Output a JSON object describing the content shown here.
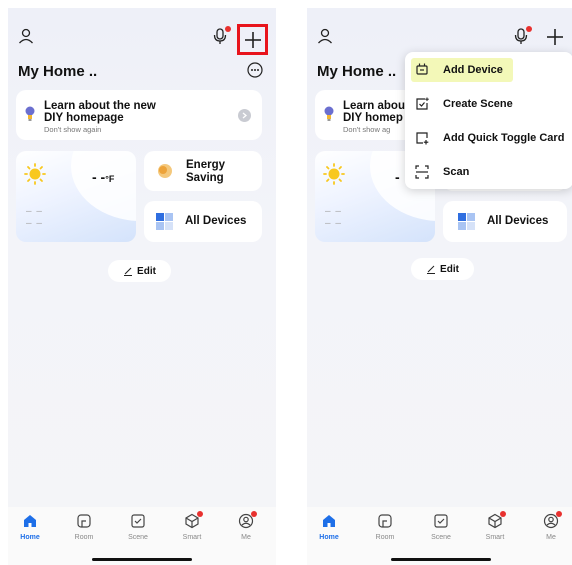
{
  "left": {
    "header": {
      "title": "My Home .."
    },
    "banner": {
      "title_line1": "Learn about the new",
      "title_line2": "DIY homepage",
      "subtitle": "Don't show again"
    },
    "weather": {
      "temperature": "- -",
      "unit": "°F",
      "placeholder_line1": "– –",
      "placeholder_line2": "– –"
    },
    "energy": {
      "line1": "Energy",
      "line2": "Saving"
    },
    "all_devices": {
      "label": "All Devices"
    },
    "edit": {
      "label": "Edit"
    },
    "tabs": [
      {
        "label": "Home",
        "icon": "home-icon"
      },
      {
        "label": "Room",
        "icon": "room-icon"
      },
      {
        "label": "Scene",
        "icon": "scene-icon"
      },
      {
        "label": "Smart",
        "icon": "smart-icon"
      },
      {
        "label": "Me",
        "icon": "me-icon"
      }
    ]
  },
  "right": {
    "header": {
      "title": "My Home .."
    },
    "banner": {
      "title_line1": "Learn abou",
      "title_line2": "DIY homep",
      "subtitle": "Don't show ag"
    },
    "weather": {
      "temperature": "-",
      "placeholder_line1": "– –",
      "placeholder_line2": "– –"
    },
    "all_devices": {
      "label": "All Devices"
    },
    "edit": {
      "label": "Edit"
    },
    "menu": [
      {
        "label": "Add Device",
        "icon": "add-device-icon",
        "highlighted": true
      },
      {
        "label": "Create Scene",
        "icon": "create-scene-icon"
      },
      {
        "label": "Add Quick Toggle Card",
        "icon": "quick-toggle-card-icon"
      },
      {
        "label": "Scan",
        "icon": "scan-icon"
      }
    ],
    "tabs": [
      {
        "label": "Home"
      },
      {
        "label": "Room"
      },
      {
        "label": "Scene"
      },
      {
        "label": "Smart"
      },
      {
        "label": "Me"
      }
    ]
  },
  "colors": {
    "accent": "#1e6fe8",
    "highlight_box": "#e8141c",
    "menu_highlight": "#f3f8b8",
    "notification": "#e8312f"
  }
}
